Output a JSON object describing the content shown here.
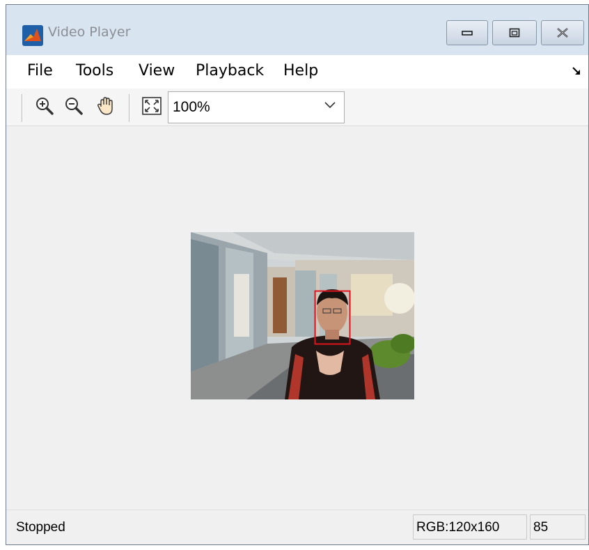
{
  "window": {
    "title": "Video Player",
    "app_icon": "matlab-logo-icon",
    "controls": [
      "minimize-icon",
      "maximize-icon",
      "close-icon"
    ]
  },
  "menubar": {
    "items": [
      {
        "label": "File"
      },
      {
        "label": "Tools"
      },
      {
        "label": "View"
      },
      {
        "label": "Playback"
      },
      {
        "label": "Help"
      }
    ],
    "dock_icon": "dock-arrow-icon"
  },
  "toolbar": {
    "buttons": [
      "zoom-in-icon",
      "zoom-out-icon",
      "pan-hand-icon",
      "fit-to-window-icon"
    ],
    "zoom": {
      "value": "100%"
    }
  },
  "canvas": {
    "video_frame": {
      "icon": "video-frame-image",
      "detection_box_color": "#e0141e"
    }
  },
  "statusbar": {
    "status": "Stopped",
    "resolution": "RGB:120x160",
    "frame": "85"
  }
}
